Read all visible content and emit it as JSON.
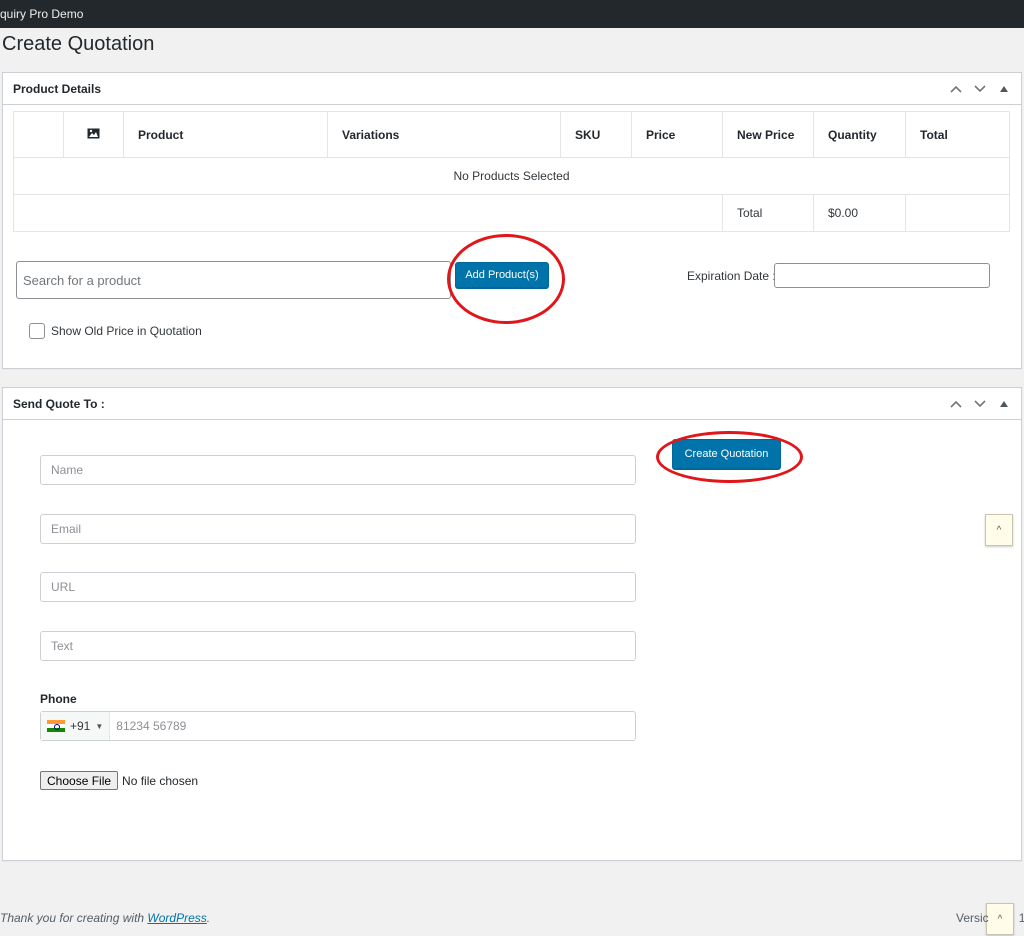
{
  "admin_bar": {
    "site_name": "quiry Pro Demo"
  },
  "page": {
    "title": "Create Quotation"
  },
  "product_details": {
    "title": "Product Details",
    "columns": [
      "",
      "",
      "Product",
      "Variations",
      "SKU",
      "Price",
      "New Price",
      "Quantity",
      "Total"
    ],
    "empty_message": "No Products Selected",
    "total_label": "Total",
    "total_value": "$0.00",
    "search_placeholder": "Search for a product",
    "add_button": "Add Product(s)",
    "expiration_label": "Expiration Date :",
    "old_price_label": "Show Old Price in Quotation"
  },
  "send_quote": {
    "title": "Send Quote To :",
    "create_button": "Create Quotation",
    "name_placeholder": "Name",
    "email_placeholder": "Email",
    "url_placeholder": "URL",
    "text_placeholder": "Text",
    "phone_label": "Phone",
    "country_code": "+91",
    "phone_placeholder": "81234 56789",
    "choose_file": "Choose File",
    "no_file": "No file chosen"
  },
  "footer": {
    "thanks_prefix": "Thank you for creating with ",
    "wordpress_link": "WordPress",
    "thanks_suffix": ".",
    "version_fragment": "Versic",
    "version_tail": "1"
  },
  "scroll_top": {
    "label": "^"
  },
  "icons": {
    "image": "image-icon",
    "collapse_up": "chevron-up-icon",
    "expand_down": "chevron-down-icon",
    "toggle": "triangle-up-icon",
    "flag": "india-flag-icon"
  },
  "colors": {
    "primary_button": "#0073aa",
    "highlight_ring": "#e0161b",
    "admin_bar": "#23282d"
  }
}
